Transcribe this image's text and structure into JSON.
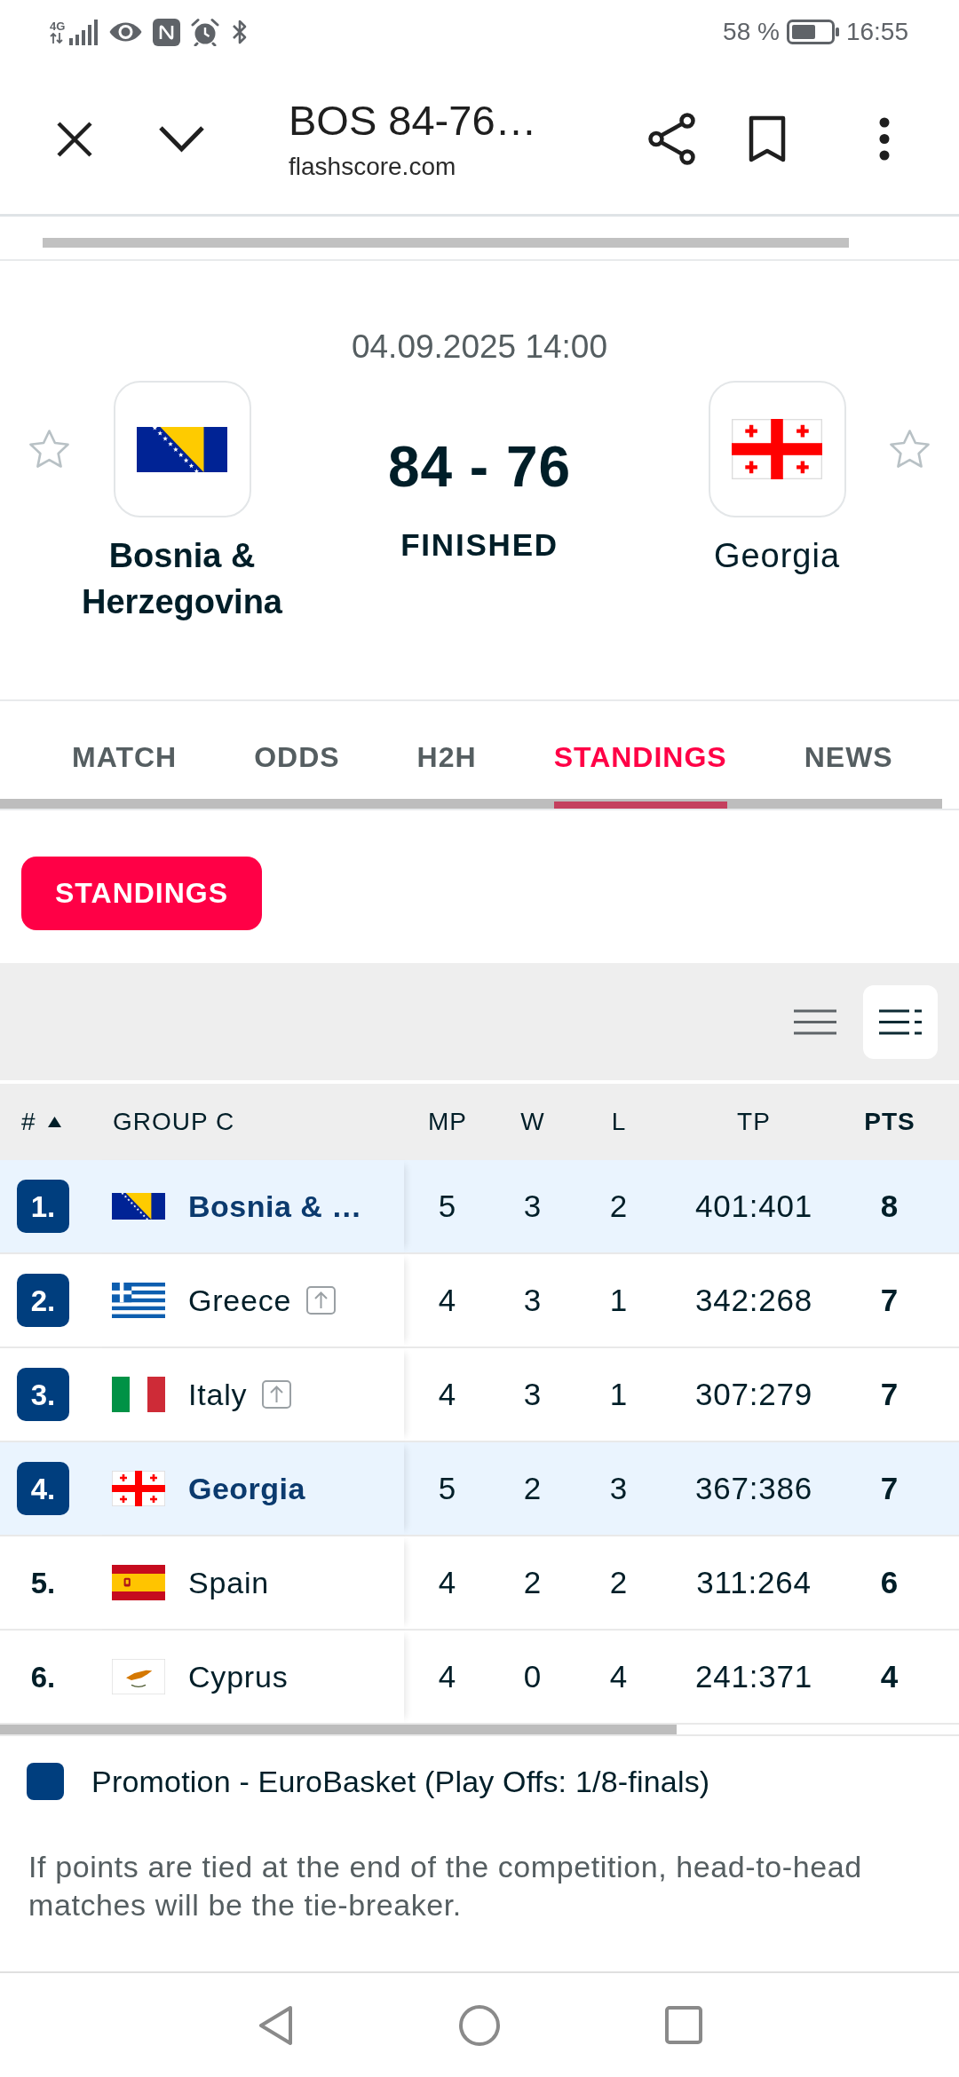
{
  "status_bar": {
    "network": "4G",
    "battery": "58 %",
    "time": "16:55"
  },
  "browser_bar": {
    "title": "BOS 84-76…",
    "domain": "flashscore.com"
  },
  "match": {
    "datetime": "04.09.2025 14:00",
    "home": {
      "name": "Bosnia & Herzegovina",
      "flag": {
        "kind": "bosnia"
      },
      "favorite": false,
      "winner": true
    },
    "score": "84 - 76",
    "status": "FINISHED",
    "away": {
      "name": "Georgia",
      "flag": {
        "kind": "georgia"
      },
      "favorite": false,
      "winner": false
    }
  },
  "tabs": [
    {
      "label": "MATCH",
      "selected": false
    },
    {
      "label": "ODDS",
      "selected": false
    },
    {
      "label": "H2H",
      "selected": false
    },
    {
      "label": "STANDINGS",
      "selected": true
    },
    {
      "label": "NEWS",
      "selected": false
    }
  ],
  "subtabs": [
    {
      "label": "STANDINGS",
      "selected": true
    }
  ],
  "view_toggle": [
    {
      "kind": "compact",
      "selected": false
    },
    {
      "kind": "full",
      "selected": true
    }
  ],
  "table": {
    "columns": [
      {
        "label": "#",
        "sorted": true,
        "emphasized": false
      },
      {
        "label": "GROUP C",
        "sorted": false,
        "emphasized": false
      },
      {
        "label": "MP",
        "sorted": false,
        "emphasized": false
      },
      {
        "label": "W",
        "sorted": false,
        "emphasized": false
      },
      {
        "label": "L",
        "sorted": false,
        "emphasized": false
      },
      {
        "label": "TP",
        "sorted": false,
        "emphasized": false
      },
      {
        "label": "PTS",
        "sorted": false,
        "emphasized": true
      }
    ],
    "rows": [
      {
        "rank": "1.",
        "color": "#003e7e",
        "flag": {
          "kind": "bosnia"
        },
        "team": "Bosnia & …",
        "highlighted": true,
        "rank_up": false,
        "values": [
          "5",
          "3",
          "2",
          "401:401",
          "8"
        ]
      },
      {
        "rank": "2.",
        "color": "#003e7e",
        "flag": {
          "kind": "greece"
        },
        "team": "Greece",
        "highlighted": false,
        "rank_up": true,
        "values": [
          "4",
          "3",
          "1",
          "342:268",
          "7"
        ]
      },
      {
        "rank": "3.",
        "color": "#003e7e",
        "flag": {
          "kind": "italy"
        },
        "team": "Italy",
        "highlighted": false,
        "rank_up": true,
        "values": [
          "4",
          "3",
          "1",
          "307:279",
          "7"
        ]
      },
      {
        "rank": "4.",
        "color": "#003e7e",
        "flag": {
          "kind": "georgia"
        },
        "team": "Georgia",
        "highlighted": true,
        "rank_up": false,
        "values": [
          "5",
          "2",
          "3",
          "367:386",
          "7"
        ]
      },
      {
        "rank": "5.",
        "flag": {
          "kind": "spain"
        },
        "team": "Spain",
        "highlighted": false,
        "rank_up": false,
        "values": [
          "4",
          "2",
          "2",
          "311:264",
          "6"
        ]
      },
      {
        "rank": "6.",
        "flag": {
          "kind": "cyprus"
        },
        "team": "Cyprus",
        "highlighted": false,
        "rank_up": false,
        "values": [
          "4",
          "0",
          "4",
          "241:371",
          "4"
        ]
      }
    ]
  },
  "legend": [
    {
      "color": "#003e7e",
      "label": "Promotion - EuroBasket (Play Offs: 1/8-finals)"
    }
  ],
  "note": "If points are tied at the end of the competition, head-to-head matches will be the tie-breaker."
}
